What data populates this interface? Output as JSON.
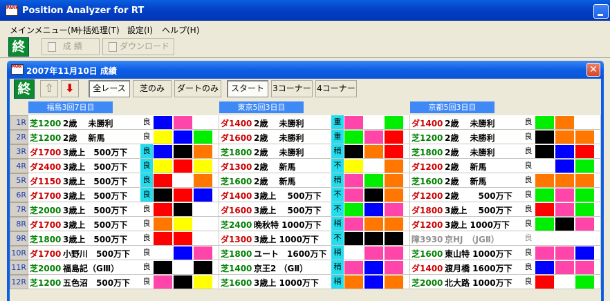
{
  "app": {
    "title": "Position Analyzer for RT",
    "icon_text": "PARKT"
  },
  "menu": [
    "メインメニュー(M)",
    "一括処理(T)",
    "設定(I)",
    "ヘルプ(H)"
  ],
  "toolbar": {
    "exit_label": "終",
    "result_label": "成 績",
    "download_label": "ダウンロード"
  },
  "child": {
    "title": "2007年11月10日 成績",
    "close": "✕"
  },
  "child_toolbar": {
    "exit_label": "終",
    "up_icon": "⇧",
    "down_icon": "⬇",
    "filters": [
      "全レース",
      "芝のみ",
      "ダートのみ"
    ],
    "positions": [
      "スタート",
      "3コーナー",
      "4コーナー"
    ]
  },
  "venues": [
    {
      "name": "福島3回7日目",
      "races": [
        {
          "r": "1R",
          "course": "芝1200",
          "surface": "turf",
          "cls": "2歳　 未勝利",
          "cond": "良",
          "colors": [
            "#0000ff",
            "#ff44aa",
            "#ffffff"
          ]
        },
        {
          "r": "2R",
          "course": "芝1200",
          "surface": "turf",
          "cls": "2歳　 新馬",
          "cond": "良",
          "colors": [
            "#ffff00",
            "#0000ff",
            "#00ee00"
          ]
        },
        {
          "r": "3R",
          "course": "ダ1700",
          "surface": "dirt",
          "cls": "3歳上　500万下",
          "cond": "良",
          "colors": [
            "#0000ff",
            "#000000",
            "#ff7700"
          ]
        },
        {
          "r": "4R",
          "course": "ダ2400",
          "surface": "dirt",
          "cls": "3歳上　500万下",
          "cond": "良",
          "colors": [
            "#ffff00",
            "#ff0000",
            "#ffff00"
          ]
        },
        {
          "r": "5R",
          "course": "ダ1150",
          "surface": "dirt",
          "cls": "3歳上　500万下",
          "cond": "良",
          "colors": [
            "#ff0000",
            "#ffffff",
            "#ff7700"
          ]
        },
        {
          "r": "6R",
          "course": "ダ1700",
          "surface": "dirt",
          "cls": "3歳上　500万下",
          "cond": "良",
          "colors": [
            "#000000",
            "#ff0000",
            "#0000ff"
          ]
        },
        {
          "r": "7R",
          "course": "芝2000",
          "surface": "turf",
          "cls": "3歳上　500万下",
          "cond": "良",
          "colors": [
            "#ff0000",
            "#000000",
            "#ffffff"
          ]
        },
        {
          "r": "8R",
          "course": "ダ1700",
          "surface": "dirt",
          "cls": "3歳上　500万下",
          "cond": "良",
          "colors": [
            "#ff7700",
            "#ffff00",
            "#ffffff"
          ]
        },
        {
          "r": "9R",
          "course": "芝1800",
          "surface": "turf",
          "cls": "3歳上　500万下",
          "cond": "良",
          "colors": [
            "#ff0000",
            "#ff0000",
            "#ffffff"
          ]
        },
        {
          "r": "10R",
          "course": "ダ1700",
          "surface": "dirt",
          "cls": "小野川　500万下",
          "cond": "良",
          "colors": [
            "#ffffff",
            "#0000ff",
            "#ff44aa"
          ]
        },
        {
          "r": "11R",
          "course": "芝2000",
          "surface": "turf",
          "cls": "福島記（GⅢ）",
          "cond": "良",
          "colors": [
            "#000000",
            "#ffffff",
            "#000000"
          ]
        },
        {
          "r": "12R",
          "course": "芝1200",
          "surface": "turf",
          "cls": "五色沼　500万下",
          "cond": "良",
          "colors": [
            "#ff44aa",
            "#000000",
            "#ffff00"
          ]
        }
      ]
    },
    {
      "name": "東京5回3日目",
      "races": [
        {
          "r": "1R",
          "course": "ダ1400",
          "surface": "dirt",
          "cls": "2歳　 未勝利",
          "cond": "重",
          "colors": [
            "#ff44aa",
            "#ffffff",
            "#00ee00"
          ]
        },
        {
          "r": "2R",
          "course": "ダ1600",
          "surface": "dirt",
          "cls": "2歳　 未勝利",
          "cond": "重",
          "colors": [
            "#00ee00",
            "#ff44aa",
            "#ff0000"
          ]
        },
        {
          "r": "3R",
          "course": "芝1800",
          "surface": "turf",
          "cls": "2歳　 未勝利",
          "cond": "稍",
          "colors": [
            "#000000",
            "#ff7700",
            "#ff0000"
          ]
        },
        {
          "r": "4R",
          "course": "ダ1300",
          "surface": "dirt",
          "cls": "2歳　 新馬",
          "cond": "不",
          "colors": [
            "#ffff00",
            "#ffffff",
            "#ff7700"
          ]
        },
        {
          "r": "5R",
          "course": "芝1600",
          "surface": "turf",
          "cls": "2歳　 新馬",
          "cond": "稍",
          "colors": [
            "#ff44aa",
            "#00ee00",
            "#ff7700"
          ]
        },
        {
          "r": "6R",
          "course": "ダ1400",
          "surface": "dirt",
          "cls": "3歳上　 500万下",
          "cond": "不",
          "colors": [
            "#ff44aa",
            "#000000",
            "#ff7700"
          ]
        },
        {
          "r": "7R",
          "course": "ダ1600",
          "surface": "dirt",
          "cls": "3歳上　 500万下",
          "cond": "不",
          "colors": [
            "#00ee00",
            "#0000ff",
            "#ff44aa"
          ]
        },
        {
          "r": "8R",
          "course": "芝2400",
          "surface": "turf",
          "cls": "晩秋特 1000万下",
          "cond": "稍",
          "colors": [
            "#ff44aa",
            "#ff7700",
            "#ff7700"
          ]
        },
        {
          "r": "9R",
          "course": "ダ1300",
          "surface": "dirt",
          "cls": "3歳上 1000万下",
          "cond": "不",
          "colors": [
            "#000000",
            "#000000",
            "#000000"
          ]
        },
        {
          "r": "10R",
          "course": "芝1800",
          "surface": "turf",
          "cls": "ユート　1600万下",
          "cond": "稍",
          "colors": [
            "#ffffff",
            "#ff44aa",
            "#ff44aa"
          ]
        },
        {
          "r": "11R",
          "course": "芝1400",
          "surface": "turf",
          "cls": "京王2 （GⅡ）",
          "cond": "稍",
          "colors": [
            "#ff44aa",
            "#0000ff",
            "#ff44aa"
          ]
        },
        {
          "r": "12R",
          "course": "芝1600",
          "surface": "turf",
          "cls": "3歳上 1000万下",
          "cond": "稍",
          "colors": [
            "#ff7700",
            "#0000ff",
            "#ff7700"
          ]
        }
      ]
    },
    {
      "name": "京都5回3日目",
      "races": [
        {
          "r": "1R",
          "course": "ダ1400",
          "surface": "dirt",
          "cls": "2歳　 未勝利",
          "cond": "良",
          "colors": [
            "#00ee00",
            "#ff7700",
            "#ffffff"
          ]
        },
        {
          "r": "2R",
          "course": "芝1200",
          "surface": "turf",
          "cls": "2歳　 未勝利",
          "cond": "良",
          "colors": [
            "#000000",
            "#ff7700",
            "#ff7700"
          ]
        },
        {
          "r": "3R",
          "course": "芝1800",
          "surface": "turf",
          "cls": "2歳　 未勝利",
          "cond": "良",
          "colors": [
            "#000000",
            "#0000ff",
            "#ff0000"
          ]
        },
        {
          "r": "4R",
          "course": "ダ1200",
          "surface": "dirt",
          "cls": "2歳　 新馬",
          "cond": "良",
          "colors": [
            "#ffffff",
            "#0000ff",
            "#00ee00"
          ]
        },
        {
          "r": "5R",
          "course": "芝1600",
          "surface": "turf",
          "cls": "2歳　 新馬",
          "cond": "良",
          "colors": [
            "#ff7700",
            "#ff7700",
            "#ff7700"
          ]
        },
        {
          "r": "6R",
          "course": "ダ1200",
          "surface": "dirt",
          "cls": "2歳　　 500万下",
          "cond": "良",
          "colors": [
            "#00ee00",
            "#ff44aa",
            "#00ee00"
          ]
        },
        {
          "r": "7R",
          "course": "ダ1800",
          "surface": "dirt",
          "cls": "3歳上　 500万下",
          "cond": "良",
          "colors": [
            "#ff0000",
            "#ff44aa",
            "#00ee00"
          ]
        },
        {
          "r": "8R",
          "course": "ダ1200",
          "surface": "dirt",
          "cls": "3歳上 1000万下",
          "cond": "良",
          "colors": [
            "#00ee00",
            "#000000",
            "#ff44aa"
          ]
        },
        {
          "r": "9R",
          "course": "障3930",
          "surface": "jump",
          "cls": "京HJ　（JGⅡ）",
          "cond": "良",
          "colors": [
            "#ffffff",
            "#ffffff",
            "#ffffff"
          ]
        },
        {
          "r": "10R",
          "course": "芝1600",
          "surface": "turf",
          "cls": "東山特 1000万下",
          "cond": "良",
          "colors": [
            "#ff44aa",
            "#ff44aa",
            "#0000ff"
          ]
        },
        {
          "r": "11R",
          "course": "ダ1400",
          "surface": "dirt",
          "cls": "渡月橋 1600万下",
          "cond": "良",
          "colors": [
            "#0000ff",
            "#ff44aa",
            "#ff44aa"
          ]
        },
        {
          "r": "12R",
          "course": "芝2000",
          "surface": "turf",
          "cls": "北大路 1000万下",
          "cond": "良",
          "colors": [
            "#ff0000",
            "#ffffff",
            "#00ee00"
          ]
        }
      ]
    }
  ],
  "colors": {
    "turf": "#008000",
    "dirt": "#cc0000",
    "jump": "#909090",
    "cond_highlight": "#22ddee"
  }
}
